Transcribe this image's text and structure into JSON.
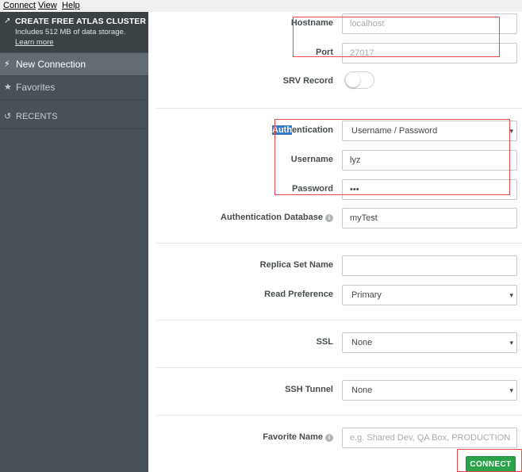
{
  "menubar": {
    "items": [
      "Connect",
      "View",
      "Help"
    ]
  },
  "sidebar": {
    "atlas": {
      "title": "CREATE FREE ATLAS CLUSTER",
      "subtitle": "Includes 512 MB of data storage.",
      "link": "Learn more",
      "icon": "external-link-icon"
    },
    "new_connection": {
      "label": "New Connection",
      "icon": "bolt-icon"
    },
    "favorites": {
      "label": "Favorites",
      "icon": "star-icon"
    },
    "recents": {
      "label": "RECENTS",
      "icon": "history-icon"
    }
  },
  "form": {
    "hostname": {
      "label": "Hostname",
      "value": "localhost"
    },
    "port": {
      "label": "Port",
      "value": "27017"
    },
    "srv_record": {
      "label": "SRV Record",
      "enabled": false
    },
    "authentication": {
      "label_highlight": "Auth",
      "label_rest": "entication",
      "value": "Username / Password"
    },
    "username": {
      "label": "Username",
      "value": "lyz"
    },
    "password": {
      "label": "Password",
      "value": "•••"
    },
    "auth_database": {
      "label": "Authentication Database",
      "value": "myTest",
      "icon": "info-icon"
    },
    "replica_set": {
      "label": "Replica Set Name",
      "value": ""
    },
    "read_preference": {
      "label": "Read Preference",
      "value": "Primary"
    },
    "ssl": {
      "label": "SSL",
      "value": "None"
    },
    "ssh_tunnel": {
      "label": "SSH Tunnel",
      "value": "None"
    },
    "favorite_name": {
      "label": "Favorite Name",
      "placeholder": "e.g. Shared Dev, QA Box, PRODUCTION",
      "icon": "info-icon"
    },
    "connect_label": "CONNECT"
  },
  "colors": {
    "sidebar_bg": "#485158",
    "sidebar_active": "#636c72",
    "annotation_red": "#e8474b",
    "connect_green": "#2aa34b",
    "selection_blue": "#3a78c9"
  }
}
